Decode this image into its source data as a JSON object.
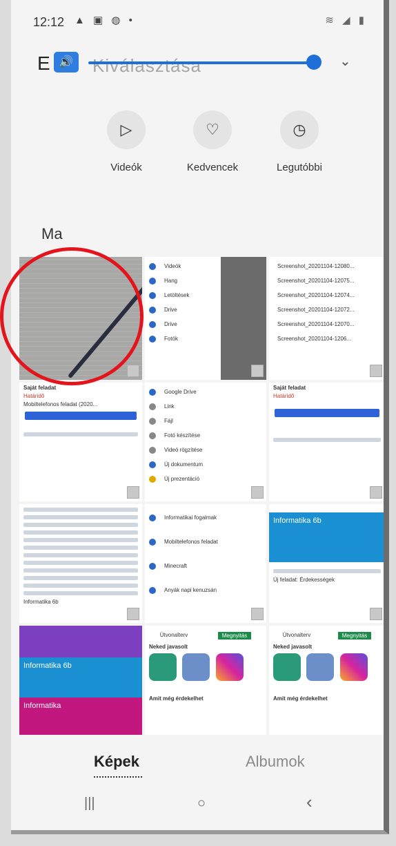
{
  "status": {
    "time": "12:12",
    "left_icons": "▲ ▣ ◍ •",
    "right_icons": "≋ ◢ ▮"
  },
  "volume": {
    "letter": "E",
    "ghost_text": "Kiválasztása",
    "speaker_glyph": "🔊",
    "chevron": "⌄",
    "level": 0.95
  },
  "categories": [
    {
      "label": "Videók",
      "icon": "▷"
    },
    {
      "label": "Kedvencek",
      "icon": "♡"
    },
    {
      "label": "Legutóbbi",
      "icon": "◷"
    }
  ],
  "section": {
    "title": "Ma"
  },
  "tiles": {
    "t2": {
      "items": [
        "Videók",
        "Hang",
        "Letöltések",
        "Drive",
        "Drive",
        "Fotók"
      ]
    },
    "t3": {
      "items": [
        "Screenshot_20201104-12080...",
        "Screenshot_20201104-12075...",
        "Screenshot_20201104-12074...",
        "Screenshot_20201104-12072...",
        "Screenshot_20201104-12070...",
        "Screenshot_20201104-1206..."
      ]
    },
    "t4": {
      "title": "Saját feladat",
      "badge": "Határidő",
      "file": "Mobiltelefonos feladat (2020..."
    },
    "t5": {
      "items": [
        "Google Drive",
        "Link",
        "Fájl",
        "Fotó készítése",
        "Videó rögzítése",
        "Új dokumentum",
        "Új prezentáció"
      ]
    },
    "t6": {
      "title": "Saját feladat",
      "badge": "Határidő"
    },
    "t7": {
      "lines": [
        "Informatika 6b"
      ]
    },
    "t8": {
      "items": [
        "Informatikai fogalmak",
        "Mobiltelefonos feladat",
        "Minecraft",
        "Anyák napi kenuzsán"
      ]
    },
    "t9": {
      "banner": "Informatika 6b",
      "note": "Új feladat: Érdekességek"
    },
    "t10": {
      "banners": [
        "Informatika 6b",
        "Informatika"
      ]
    },
    "t11": {
      "tab_a": "Útvonalterv",
      "tab_b": "Megnyitás",
      "header": "Neked javasolt",
      "footer": "Amit még érdekelhet"
    },
    "t12": {
      "tab_a": "Útvonalterv",
      "tab_b": "Megnyitás",
      "header": "Neked javasolt",
      "footer": "Amit még érdekelhet"
    }
  },
  "tabs": {
    "active": "Képek",
    "inactive": "Albumok"
  },
  "nav": {
    "recents": "|||",
    "home": "○",
    "back": "‹"
  },
  "colors": {
    "accent": "#1f6fd9",
    "highlight_circle": "#e3141c",
    "green": "#1e8a4a"
  }
}
